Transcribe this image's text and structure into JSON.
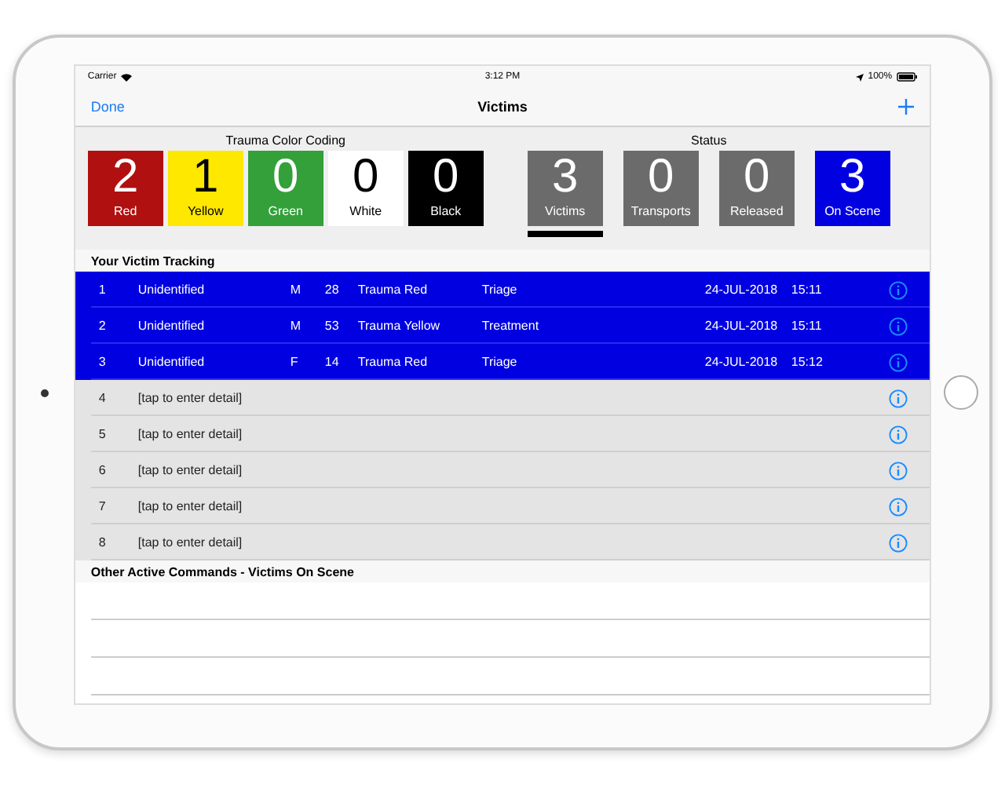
{
  "status_bar": {
    "carrier": "Carrier",
    "time": "3:12 PM",
    "battery": "100%"
  },
  "nav": {
    "left": "Done",
    "title": "Victims"
  },
  "trauma_coding": {
    "title": "Trauma Color Coding",
    "tiles": [
      {
        "count": "2",
        "label": "Red",
        "color": "#b01010"
      },
      {
        "count": "1",
        "label": "Yellow",
        "color": "#ffe800"
      },
      {
        "count": "0",
        "label": "Green",
        "color": "#33a03a"
      },
      {
        "count": "0",
        "label": "White",
        "color": "#ffffff"
      },
      {
        "count": "0",
        "label": "Black",
        "color": "#000000"
      }
    ]
  },
  "status": {
    "title": "Status",
    "tiles": [
      {
        "count": "3",
        "label": "Victims",
        "color": "#6b6b6b",
        "selected": true
      },
      {
        "count": "0",
        "label": "Transports",
        "color": "#6b6b6b",
        "selected": false
      },
      {
        "count": "0",
        "label": "Released",
        "color": "#6b6b6b",
        "selected": false
      },
      {
        "count": "3",
        "label": "On Scene",
        "color": "#0000e0",
        "selected": false
      }
    ]
  },
  "tracking": {
    "title": "Your Victim Tracking",
    "rows": [
      {
        "kind": "victim",
        "number": "1",
        "name": "Unidentified",
        "sex": "M",
        "age": "28",
        "trauma": "Trauma Red",
        "stage": "Triage",
        "date": "24-JUL-2018",
        "time": "15:11"
      },
      {
        "kind": "victim",
        "number": "2",
        "name": "Unidentified",
        "sex": "M",
        "age": "53",
        "trauma": "Trauma Yellow",
        "stage": "Treatment",
        "date": "24-JUL-2018",
        "time": "15:11"
      },
      {
        "kind": "victim",
        "number": "3",
        "name": "Unidentified",
        "sex": "F",
        "age": "14",
        "trauma": "Trauma Red",
        "stage": "Triage",
        "date": "24-JUL-2018",
        "time": "15:12"
      },
      {
        "kind": "empty",
        "number": "4",
        "name": "[tap to enter detail]"
      },
      {
        "kind": "empty",
        "number": "5",
        "name": "[tap to enter detail]"
      },
      {
        "kind": "empty",
        "number": "6",
        "name": "[tap to enter detail]"
      },
      {
        "kind": "empty",
        "number": "7",
        "name": "[tap to enter detail]"
      },
      {
        "kind": "empty",
        "number": "8",
        "name": "[tap to enter detail]"
      }
    ]
  },
  "other": {
    "title": "Other Active Commands - Victims On Scene"
  }
}
